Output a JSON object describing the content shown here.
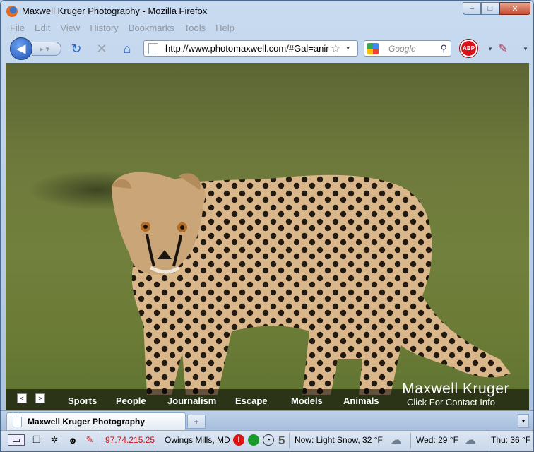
{
  "window": {
    "title": "Maxwell Kruger Photography - Mozilla Firefox",
    "controls": [
      "–",
      "□",
      "✕"
    ]
  },
  "menu": [
    "File",
    "Edit",
    "View",
    "History",
    "Bookmarks",
    "Tools",
    "Help"
  ],
  "nav": {
    "url": "http://www.photomaxwell.com/#Gal=anim",
    "search_placeholder": "Google",
    "abp_label": "ABP"
  },
  "gallery": {
    "prev_label": "<",
    "next_label": ">",
    "links": [
      "Sports",
      "People",
      "Journalism",
      "Escape",
      "Models",
      "Animals"
    ],
    "brand_name": "Maxwell Kruger",
    "contact_label": "Click For Contact Info"
  },
  "tabs": {
    "active_tab": "Maxwell Kruger Photography",
    "new_tab_label": "+"
  },
  "status": {
    "ip": "97.74.215.25",
    "location": "Owings Mills, MD",
    "count": "5",
    "now_weather": "Now: Light Snow, 32 °F",
    "wed_weather": "Wed: 29 °F",
    "thu_weather": "Thu: 36 °F"
  }
}
